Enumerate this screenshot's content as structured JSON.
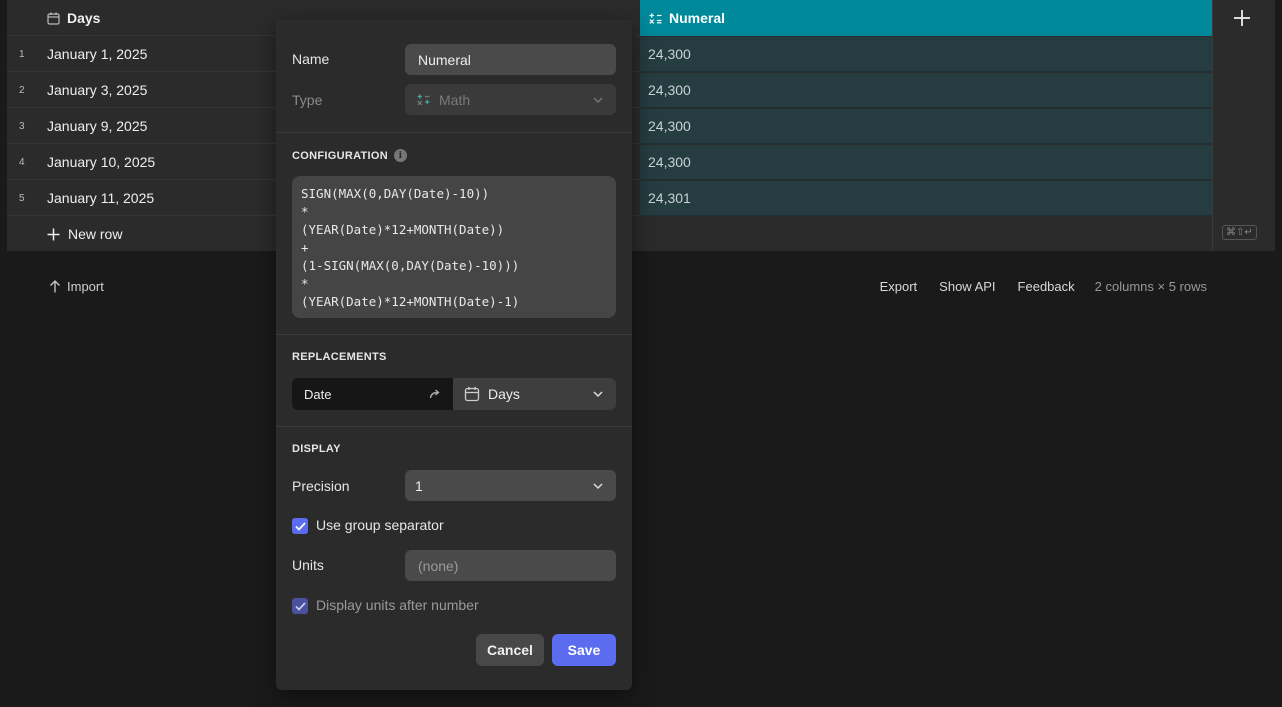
{
  "table": {
    "columns": [
      {
        "label": "Days",
        "icon": "calendar-icon"
      },
      {
        "label": "Numeral",
        "icon": "math-icon",
        "accent": "#00899b"
      }
    ],
    "rows": [
      {
        "num": "1",
        "date": "January 1, 2025",
        "value": "24,300"
      },
      {
        "num": "2",
        "date": "January 3, 2025",
        "value": "24,300"
      },
      {
        "num": "3",
        "date": "January 9, 2025",
        "value": "24,300"
      },
      {
        "num": "4",
        "date": "January 10, 2025",
        "value": "24,300"
      },
      {
        "num": "5",
        "date": "January 11, 2025",
        "value": "24,301"
      }
    ],
    "new_row_label": "New row",
    "shortcut": "⌘⇧↵"
  },
  "footer": {
    "import_label": "Import",
    "export_label": "Export",
    "show_api_label": "Show API",
    "feedback_label": "Feedback",
    "stats": "2 columns × 5 rows"
  },
  "editor": {
    "name_label": "Name",
    "name_value": "Numeral",
    "type_label": "Type",
    "type_value": "Math",
    "configuration_title": "CONFIGURATION",
    "formula": "SIGN(MAX(0,DAY(Date)-10))\n*\n(YEAR(Date)*12+MONTH(Date))\n+\n(1-SIGN(MAX(0,DAY(Date)-10)))\n*\n(YEAR(Date)*12+MONTH(Date)-1)",
    "replacements_title": "REPLACEMENTS",
    "replacement_key": "Date",
    "replacement_value": "Days",
    "display_title": "DISPLAY",
    "precision_label": "Precision",
    "precision_value": "1",
    "group_separator_label": "Use group separator",
    "group_separator_checked": true,
    "units_label": "Units",
    "units_placeholder": "(none)",
    "units_after_label": "Display units after number",
    "units_after_checked": true,
    "cancel_label": "Cancel",
    "save_label": "Save",
    "accent": "#5b6cf0"
  }
}
